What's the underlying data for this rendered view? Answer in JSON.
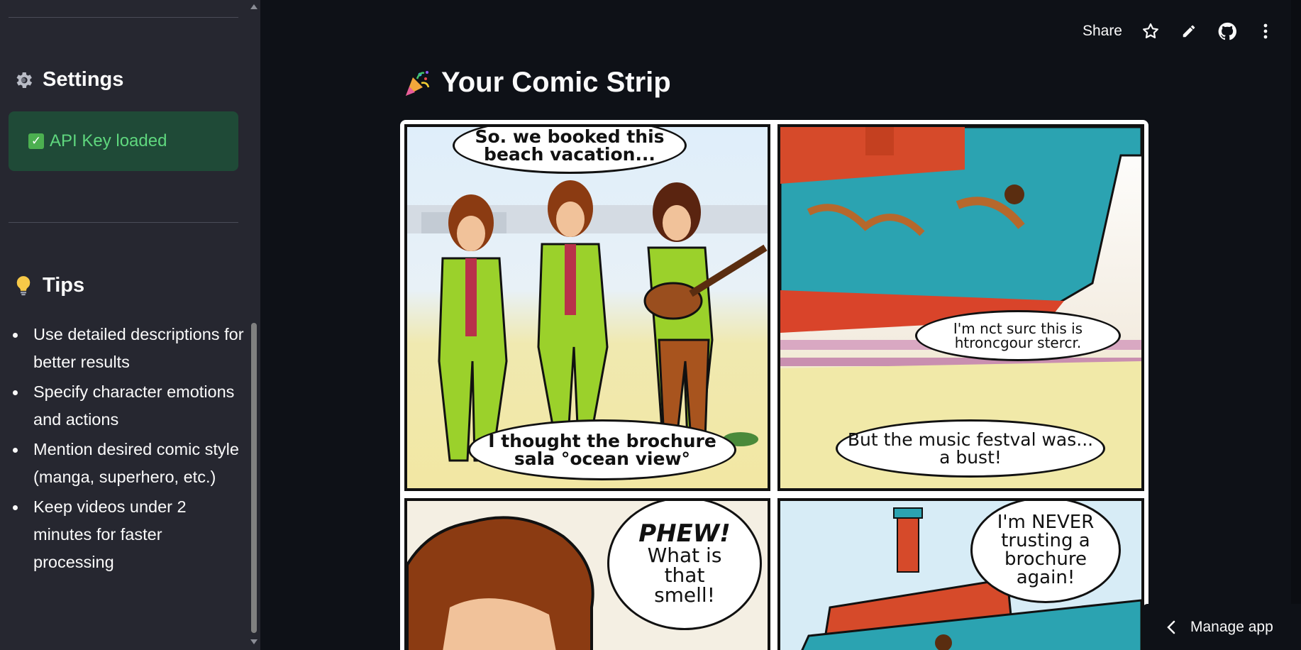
{
  "sidebar": {
    "settings_heading": "Settings",
    "settings_icon": "gear-icon",
    "status_message": "API Key loaded",
    "status_icon": "check-box-icon",
    "tips_heading": "Tips",
    "tips_icon": "lightbulb-icon",
    "tips": [
      "Use detailed descriptions for better results",
      "Specify character emotions and actions",
      "Mention desired comic style (manga, superhero, etc.)",
      "Keep videos under 2 minutes for faster processing"
    ]
  },
  "toolbar": {
    "share_label": "Share",
    "icons": [
      "star-icon",
      "pencil-icon",
      "github-icon",
      "more-vertical-icon"
    ]
  },
  "main": {
    "title": "Your Comic Strip",
    "title_icon": "party-popper-icon",
    "comic": {
      "panel1_bubble_top": "So. we booked this beach vacation...",
      "panel1_bubble_bottom": "I thought the brochure sala °ocean view°",
      "panel2_bubble_top": "I'm nct surc this is htroncgour stercr.",
      "panel2_bubble_bottom": "But the music festval was... a bust!",
      "panel3_bubble_exclaim": "PHEW!",
      "panel3_bubble_text": "What is that smell!",
      "panel4_bubble": "I'm NEVER trusting a brochure again!"
    }
  },
  "manage_app": {
    "label": "Manage app",
    "icon": "chevron-left-icon"
  },
  "colors": {
    "sidebar_bg": "#262730",
    "main_bg": "#0e1117",
    "success_bg": "#1f4a37",
    "success_text": "#5fd77e"
  }
}
